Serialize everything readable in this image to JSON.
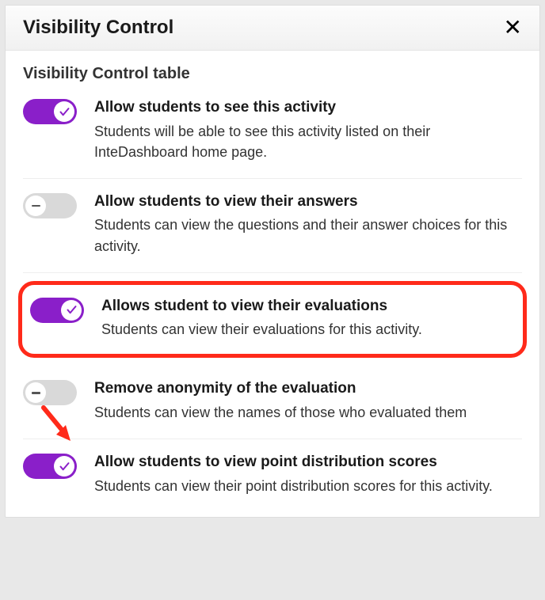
{
  "modal": {
    "title": "Visibility Control",
    "caption": "Visibility Control table"
  },
  "rows": [
    {
      "on": true,
      "highlighted": false,
      "arrow": false,
      "title": "Allow students to see this activity",
      "desc": "Students will be able to see this activity listed on their InteDashboard home page."
    },
    {
      "on": false,
      "highlighted": false,
      "arrow": false,
      "title": "Allow students to view their answers",
      "desc": "Students can view the questions and their answer choices for this activity."
    },
    {
      "on": true,
      "highlighted": true,
      "arrow": false,
      "title": "Allows student to view their evaluations",
      "desc": "Students can view their evaluations for this activity."
    },
    {
      "on": false,
      "highlighted": false,
      "arrow": false,
      "title": "Remove anonymity of the evaluation",
      "desc": "Students can view the names of those who evaluated them"
    },
    {
      "on": true,
      "highlighted": false,
      "arrow": true,
      "title": "Allow students to view point distribution scores",
      "desc": "Students can view their point distribution scores for this activity."
    }
  ]
}
